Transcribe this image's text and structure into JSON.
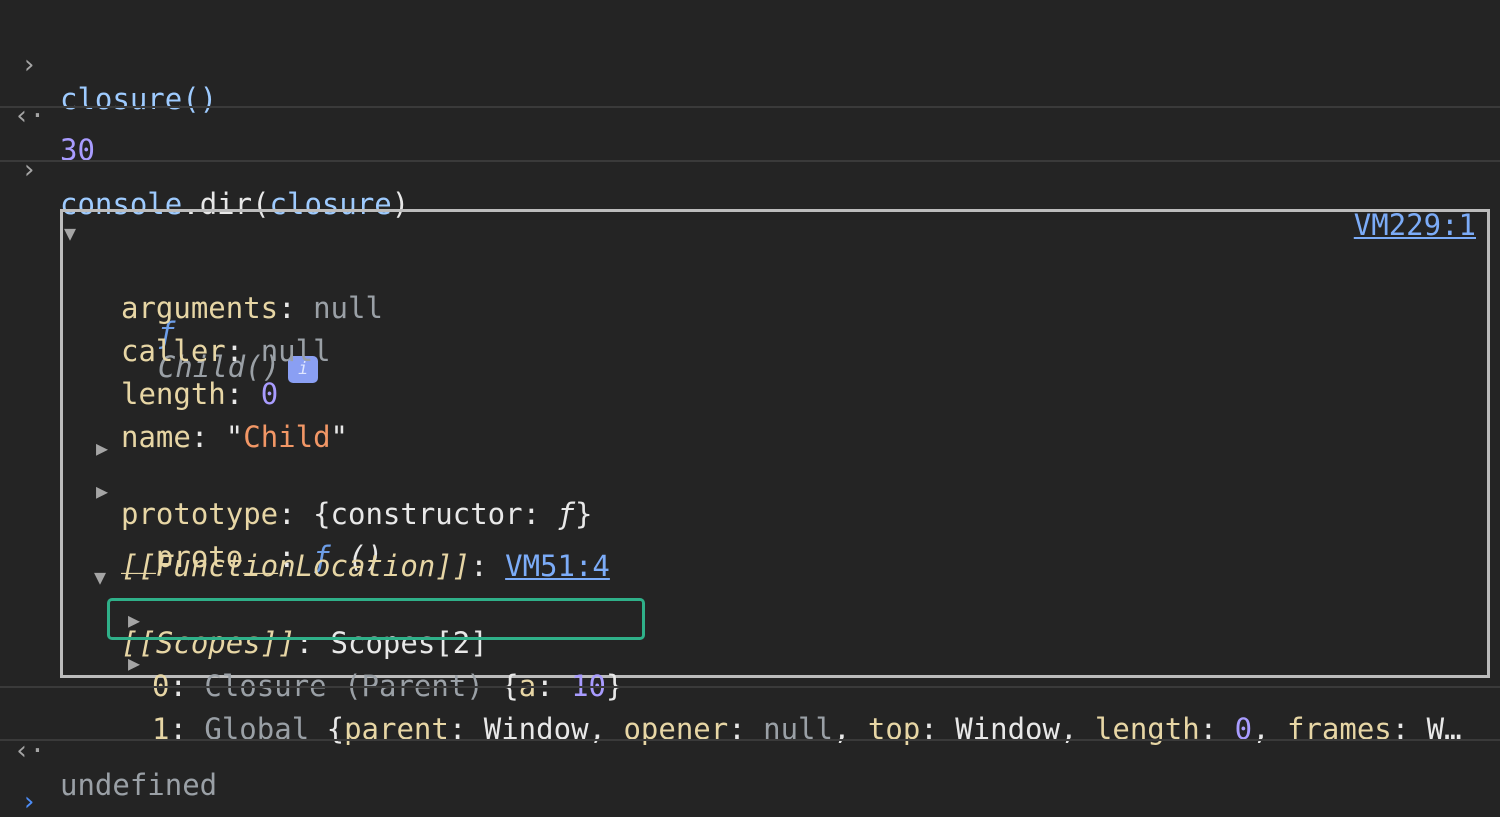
{
  "console": {
    "input1": "closure()",
    "output1": "30",
    "input2_obj": "console",
    "input2_dot": ".",
    "input2_method": "dir",
    "input2_arg": "closure",
    "source_link": "VM229:1",
    "fn_symbol": "ƒ",
    "fn_name": "Child()",
    "info_badge": "i",
    "props": {
      "arguments_key": "arguments",
      "arguments_val": "null",
      "caller_key": "caller",
      "caller_val": "null",
      "length_key": "length",
      "length_val": "0",
      "name_key": "name",
      "name_val": "Child",
      "prototype_key": "prototype",
      "prototype_val_open": "{constructor: ",
      "prototype_val_f": "ƒ",
      "prototype_val_close": "}",
      "proto_key": "__proto__",
      "proto_f": "ƒ",
      "proto_val": " ()",
      "function_location_key": "[[FunctionLocation]]",
      "function_location_val": "VM51:4",
      "scopes_key": "[[Scopes]]",
      "scopes_val": "Scopes[2]"
    },
    "scope0": {
      "index": "0",
      "label": "Closure (Parent)",
      "open": "{",
      "a_key": "a",
      "a_val": "10",
      "close": "}"
    },
    "scope1": {
      "index": "1",
      "label": "Global",
      "parent_key": "parent",
      "parent_val": "Window",
      "opener_key": "opener",
      "opener_val": "null",
      "top_key": "top",
      "top_val": "Window",
      "length_key": "length",
      "length_val": "0",
      "frames_key": "frames",
      "frames_val": "W…"
    },
    "output2": "undefined"
  },
  "gutter": {
    "input_prompt": "›",
    "output_arrow": "‹·",
    "input_caret": "›"
  }
}
